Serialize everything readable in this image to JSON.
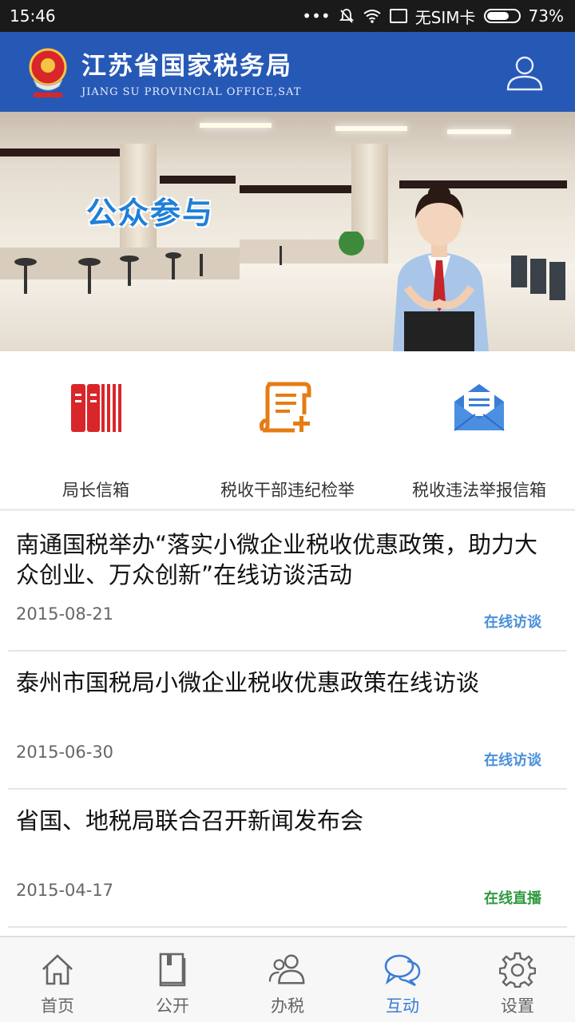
{
  "status_bar": {
    "time": "15:46",
    "sim": "无SIM卡",
    "battery": "73%",
    "battery_level": 0.73
  },
  "header": {
    "title": "江苏省国家税务局",
    "subtitle": "JIANG SU PROVINCIAL OFFICE,SAT",
    "user_icon": "user-icon"
  },
  "banner": {
    "caption": "公众参与"
  },
  "shortcuts": [
    {
      "label": "局长信箱",
      "icon": "books-icon",
      "color": "#d9262a"
    },
    {
      "label": "税收干部违纪检举",
      "icon": "scroll-plus-icon",
      "color": "#e57c14"
    },
    {
      "label": "税收违法举报信箱",
      "icon": "mail-icon",
      "color": "#3a7dd6"
    }
  ],
  "news": [
    {
      "title": "南通国税举办“落实小微企业税收优惠政策，助力大众创业、万众创新”在线访谈活动",
      "date": "2015-08-21",
      "tag": "在线访谈",
      "tag_color": "#4a90d9"
    },
    {
      "title": "泰州市国税局小微企业税收优惠政策在线访谈",
      "date": "2015-06-30",
      "tag": "在线访谈",
      "tag_color": "#4a90d9"
    },
    {
      "title": "省国、地税局联合召开新闻发布会",
      "date": "2015-04-17",
      "tag": "在线直播",
      "tag_color": "#2e9a3e"
    }
  ],
  "bottom_nav": [
    {
      "label": "首页",
      "icon": "home-icon",
      "active": false
    },
    {
      "label": "公开",
      "icon": "book-icon",
      "active": false
    },
    {
      "label": "办税",
      "icon": "people-icon",
      "active": false
    },
    {
      "label": "互动",
      "icon": "chat-icon",
      "active": true
    },
    {
      "label": "设置",
      "icon": "gear-icon",
      "active": false
    }
  ],
  "colors": {
    "header_bg": "#2658b6",
    "accent": "#3a7dd6",
    "nav_inactive": "#666666"
  }
}
